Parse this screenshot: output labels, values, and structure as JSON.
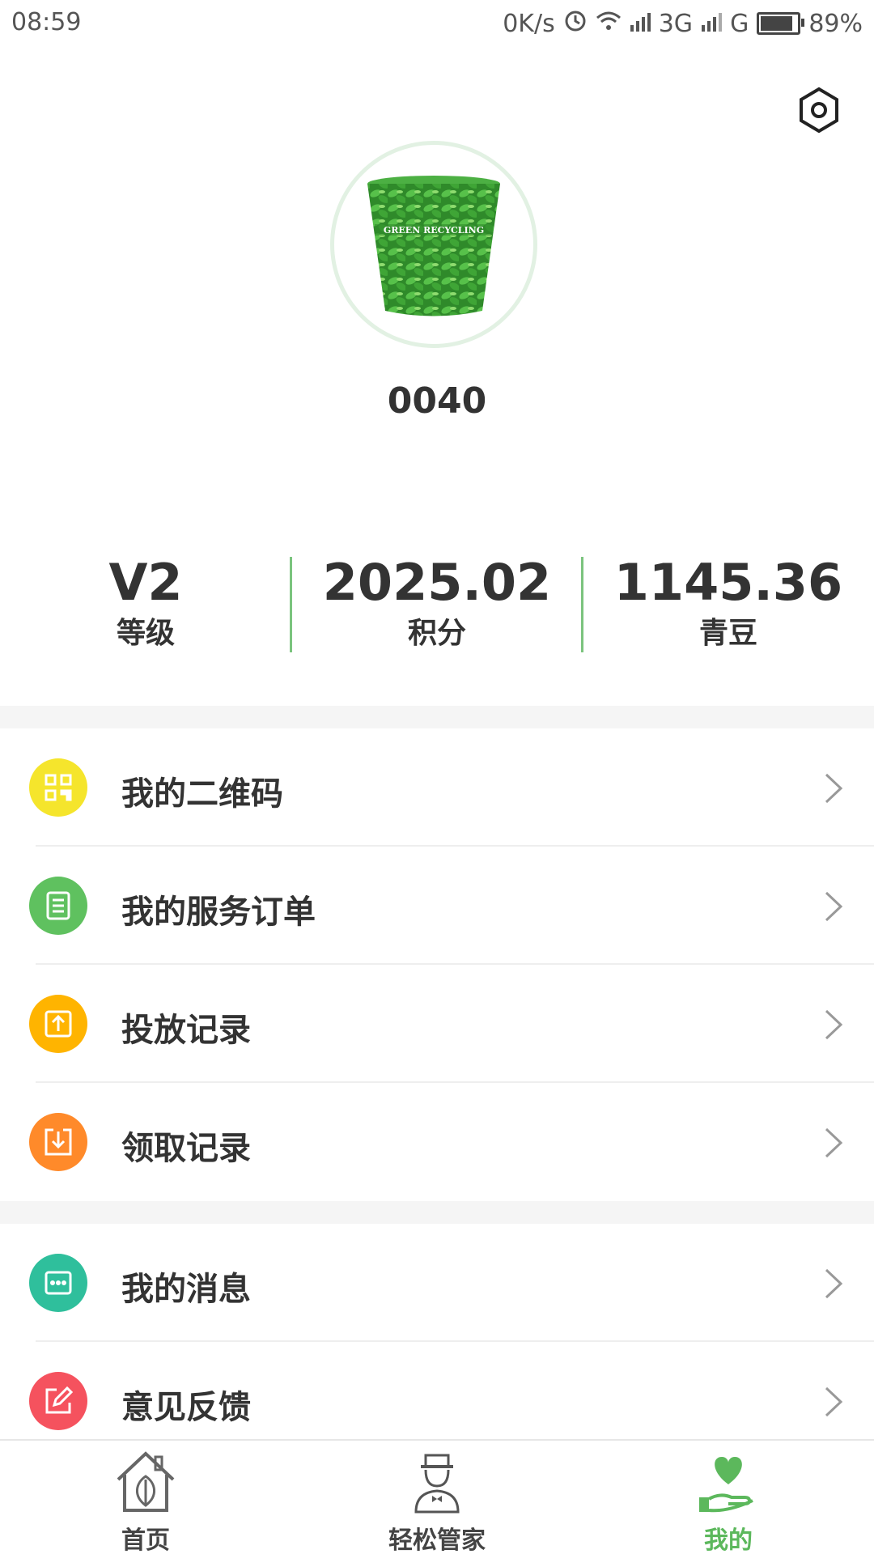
{
  "status_bar": {
    "time": "08:59",
    "network_speed": "0K/s",
    "signal_1": "3G",
    "signal_2": "G",
    "battery_percent": "89%",
    "battery_level": 0.89
  },
  "header": {
    "settings_icon": "settings-hexagon-icon"
  },
  "profile": {
    "avatar_icon": "green-recycling-bin-avatar",
    "username": "0040"
  },
  "stats": [
    {
      "value": "V2",
      "label": "等级"
    },
    {
      "value": "2025.02",
      "label": "积分"
    },
    {
      "value": "1145.36",
      "label": "青豆"
    }
  ],
  "menu_group_1": [
    {
      "label": "我的二维码",
      "icon": "qr-code-icon",
      "color": "#f5e52c"
    },
    {
      "label": "我的服务订单",
      "icon": "order-list-icon",
      "color": "#5fc15f"
    },
    {
      "label": "投放记录",
      "icon": "upload-box-icon",
      "color": "#ffb400"
    },
    {
      "label": "领取记录",
      "icon": "download-box-icon",
      "color": "#ff8a2a"
    }
  ],
  "menu_group_2": [
    {
      "label": "我的消息",
      "icon": "message-icon",
      "color": "#2fbf9c"
    },
    {
      "label": "意见反馈",
      "icon": "edit-feedback-icon",
      "color": "#f5525e"
    }
  ],
  "tabs": [
    {
      "label": "首页",
      "icon": "home-leaf-icon",
      "active": false
    },
    {
      "label": "轻松管家",
      "icon": "butler-icon",
      "active": false
    },
    {
      "label": "我的",
      "icon": "heart-hand-icon",
      "active": true
    }
  ],
  "colors": {
    "accent_green": "#5cb85c",
    "divider_green": "#7bc47e"
  }
}
